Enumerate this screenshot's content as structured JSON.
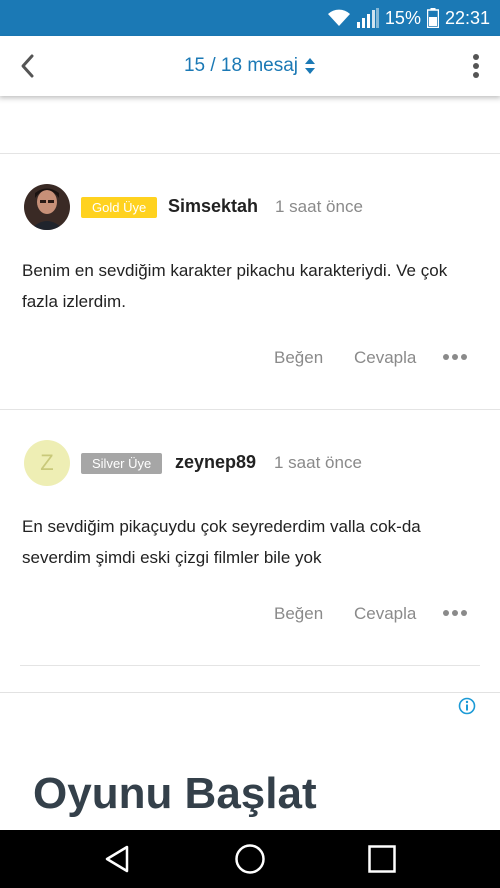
{
  "status_bar": {
    "battery_text": "15%",
    "time": "22:31",
    "icons": [
      "wifi-icon",
      "signal-icon",
      "battery-icon"
    ]
  },
  "app_bar": {
    "title": "15 / 18 mesaj",
    "back_icon": "chevron-left-icon",
    "sort_icon": "sort-updown-icon",
    "menu_icon": "kebab-menu-icon",
    "accent_color": "#1b79b5"
  },
  "posts": [
    {
      "badge": "Gold Üye",
      "badge_color": "#ffd21f",
      "username": "Simsektah",
      "time": "1 saat önce",
      "body": "Benim en sevdiğim karakter pikachu karakteriydi. Ve çok fazla izlerdim.",
      "like": "Beğen",
      "reply": "Cevapla",
      "more_icon": "more-horizontal-icon"
    },
    {
      "avatar_letter": "Z",
      "badge": "Silver Üye",
      "badge_color": "#a6a6a6",
      "username": "zeynep89",
      "time": "1 saat önce",
      "body": "En sevdiğim pikaçuydu çok seyrederdim valla cok-da severdim şimdi eski çizgi filmler bile yok",
      "like": "Beğen",
      "reply": "Cevapla",
      "more_icon": "more-horizontal-icon"
    }
  ],
  "ad": {
    "headline": "Oyunu Başlat",
    "info_icon": "info-icon"
  },
  "nav_bar": {
    "icons": [
      "back-triangle-icon",
      "home-circle-icon",
      "recents-square-icon"
    ]
  }
}
